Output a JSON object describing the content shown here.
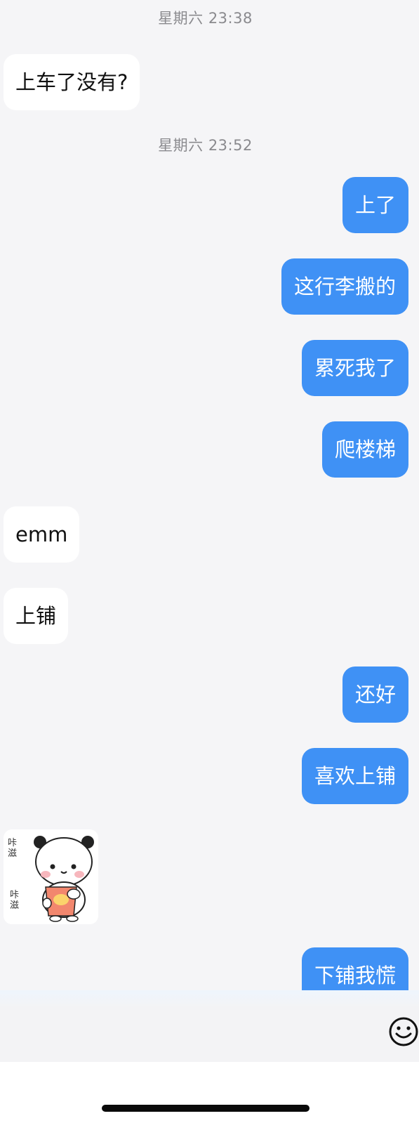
{
  "conversation": {
    "timestamps": [
      "星期六 23:38",
      "星期六 23:52"
    ],
    "messages": [
      {
        "from": "other",
        "text": "上车了没有?"
      },
      {
        "from": "me",
        "text": "上了"
      },
      {
        "from": "me",
        "text": "这行李搬的"
      },
      {
        "from": "me",
        "text": "累死我了"
      },
      {
        "from": "me",
        "text": "爬楼梯"
      },
      {
        "from": "other",
        "text": "emm"
      },
      {
        "from": "other",
        "text": "上铺"
      },
      {
        "from": "me",
        "text": "还好"
      },
      {
        "from": "me",
        "text": "喜欢上铺"
      },
      {
        "from": "me",
        "text": "下铺我慌"
      }
    ],
    "sticker": {
      "icon": "panda-bear-sticker",
      "caption_left_top": "咔滋",
      "caption_left_bottom": "咔滋"
    }
  },
  "input_bar": {
    "emoji_icon": "smiley-face-icon"
  },
  "colors": {
    "background": "#f5f5f7",
    "incoming_bubble": "#ffffff",
    "outgoing_bubble": "#3f91f5",
    "timestamp_text": "#8a8a8e"
  }
}
